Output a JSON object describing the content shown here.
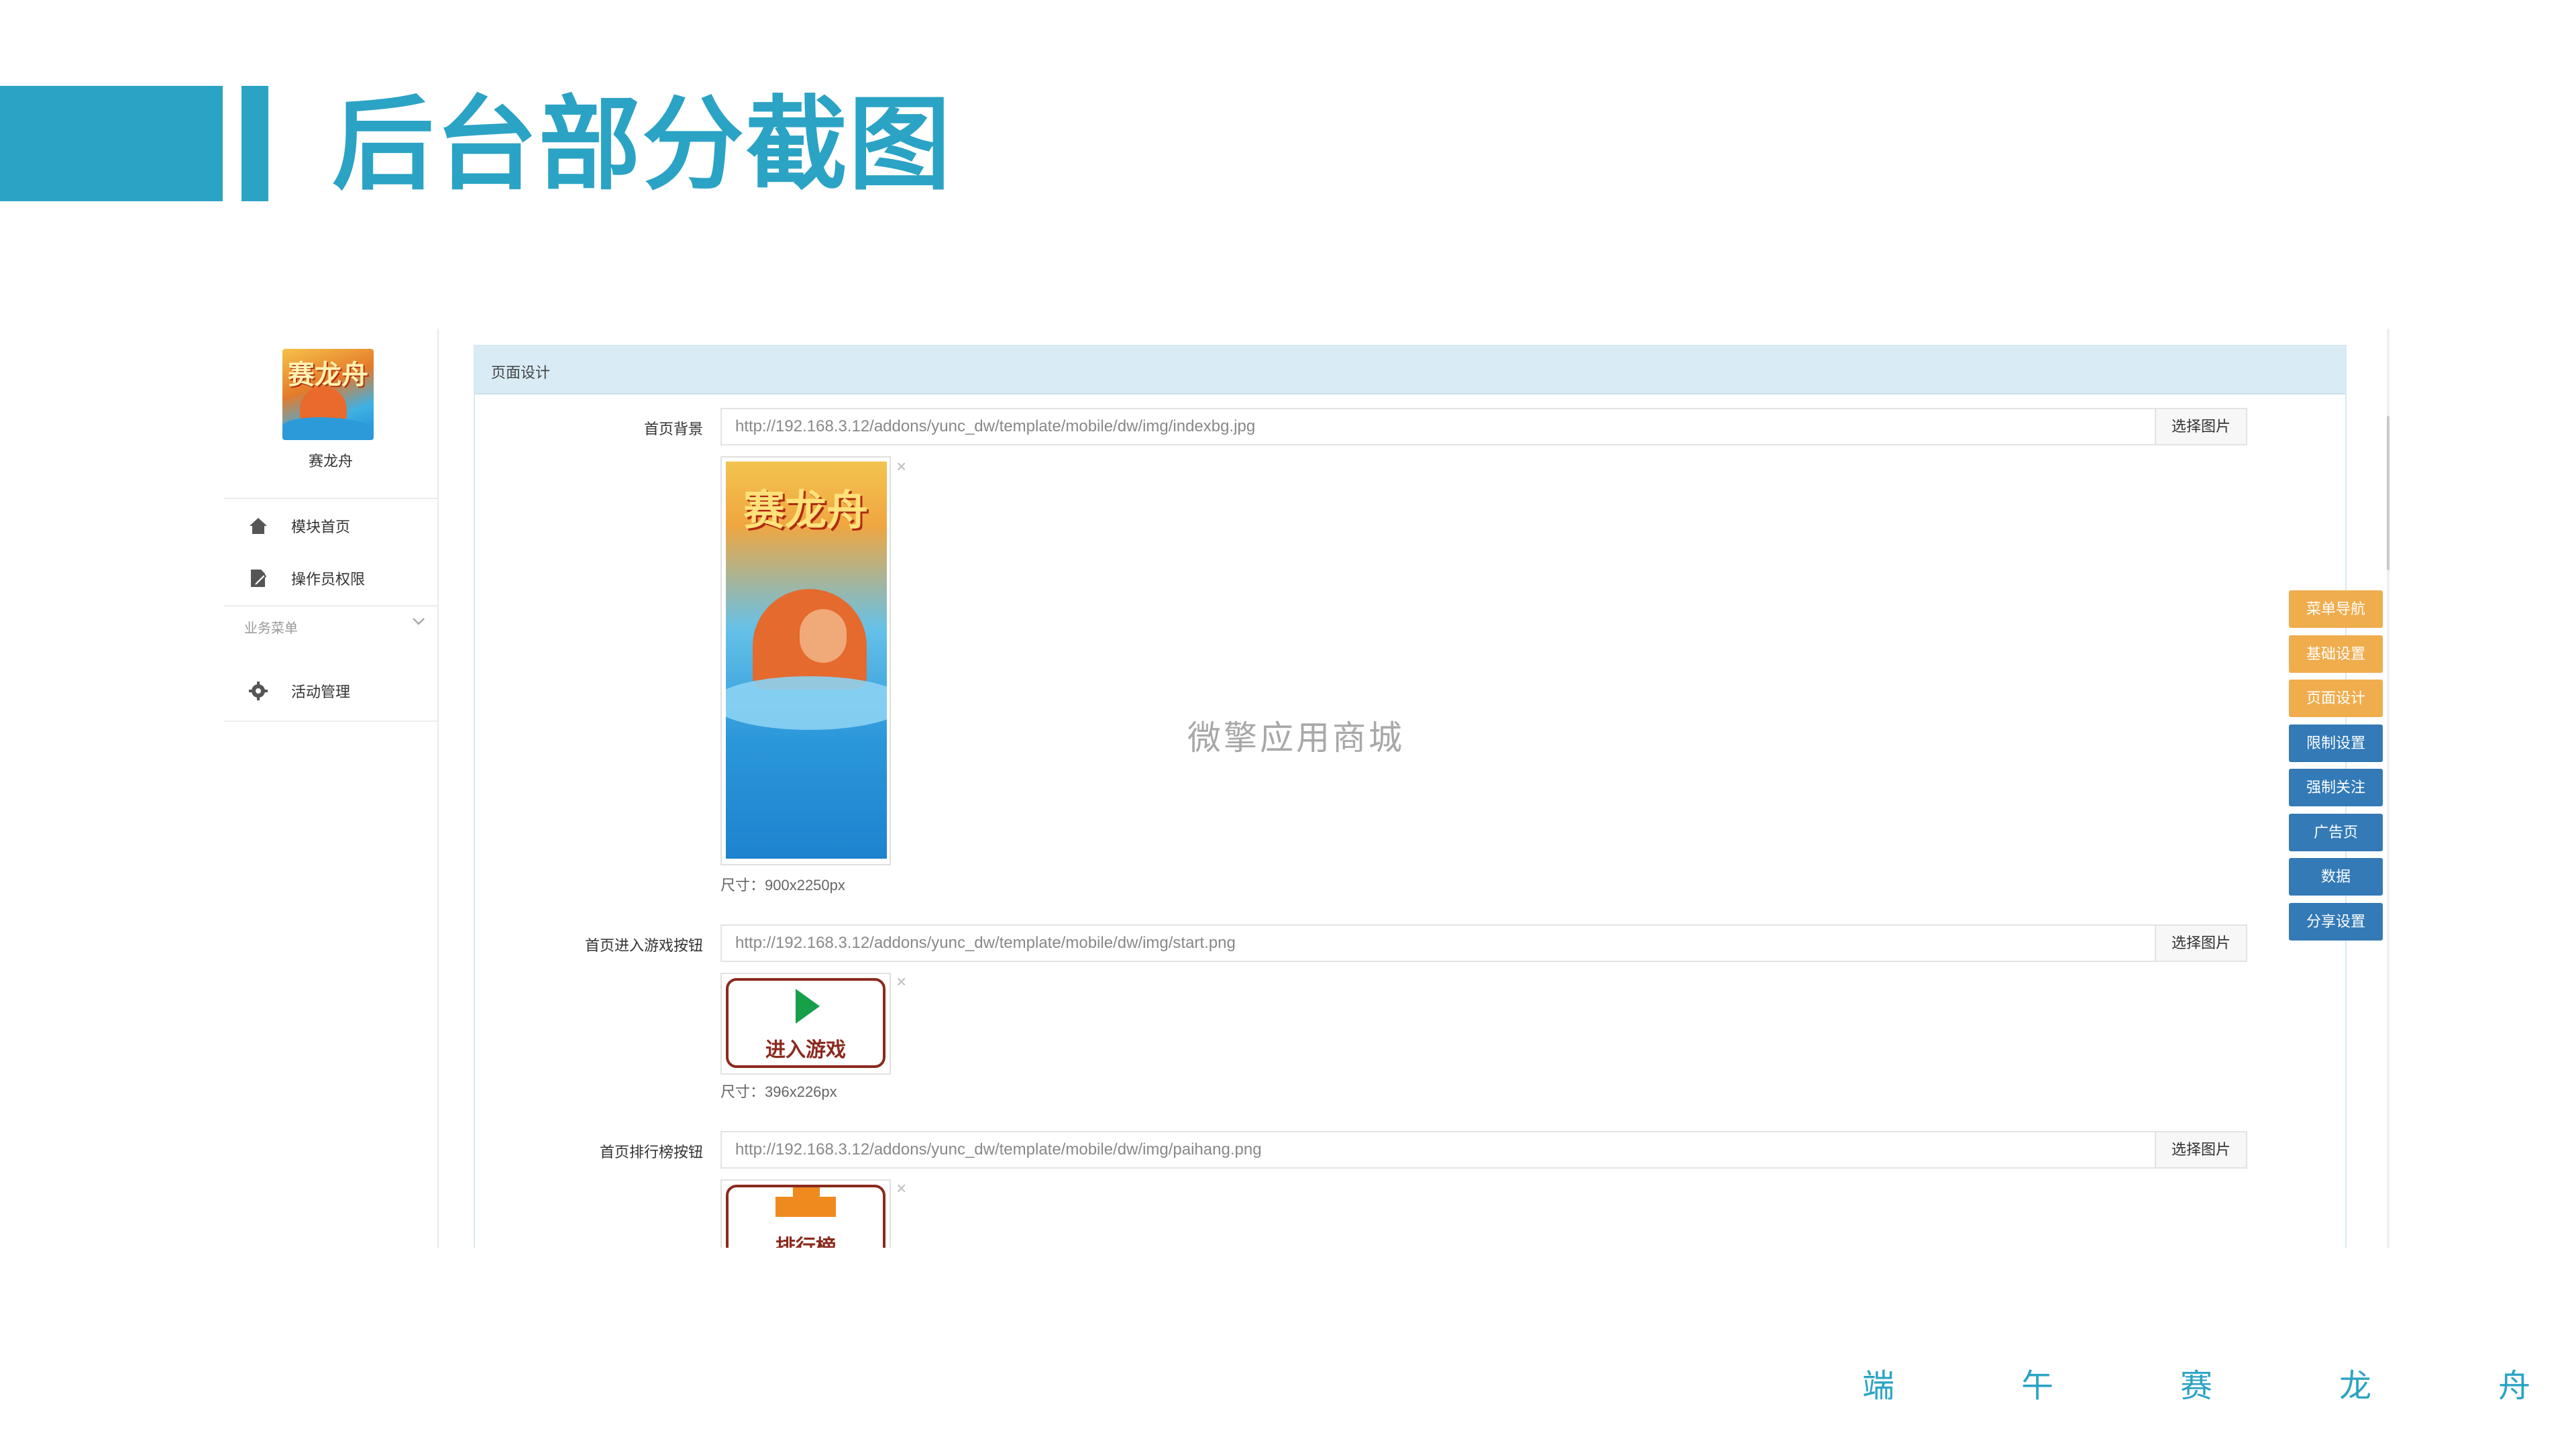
{
  "slide": {
    "title": "后台部分截图",
    "footer_chars": [
      "端",
      "午",
      "赛",
      "龙",
      "舟"
    ],
    "accent_color": "#2ba3c4"
  },
  "sidebar": {
    "app_name": "赛龙舟",
    "logo_text": "赛龙舟",
    "items": [
      {
        "label": "模块首页",
        "icon": "home-icon"
      },
      {
        "label": "操作员权限",
        "icon": "document-edit-icon"
      }
    ],
    "group_label": "业务菜单",
    "group_items": [
      {
        "label": "活动管理",
        "icon": "gear-icon"
      }
    ]
  },
  "panel": {
    "title": "页面设计",
    "fields": [
      {
        "label": "首页背景",
        "value": "http://192.168.3.12/addons/yunc_dw/template/mobile/dw/img/indexbg.jpg",
        "button": "选择图片",
        "close": "×",
        "size_note": "尺寸：900x2250px",
        "image_text": "赛龙舟"
      },
      {
        "label": "首页进入游戏按钮",
        "value": "http://192.168.3.12/addons/yunc_dw/template/mobile/dw/img/start.png",
        "button": "选择图片",
        "close": "×",
        "size_note": "尺寸：396x226px",
        "image_text": "进入游戏"
      },
      {
        "label": "首页排行榜按钮",
        "value": "http://192.168.3.12/addons/yunc_dw/template/mobile/dw/img/paihang.png",
        "button": "选择图片",
        "close": "×",
        "image_text": "排行榜"
      }
    ],
    "watermark": "微擎应用商城"
  },
  "float_nav": [
    {
      "label": "菜单导航",
      "color": "#f0ad4e"
    },
    {
      "label": "基础设置",
      "color": "#f0ad4e"
    },
    {
      "label": "页面设计",
      "color": "#f0ad4e"
    },
    {
      "label": "限制设置",
      "color": "#337ab7"
    },
    {
      "label": "强制关注",
      "color": "#337ab7"
    },
    {
      "label": "广告页",
      "color": "#337ab7"
    },
    {
      "label": "数据",
      "color": "#337ab7"
    },
    {
      "label": "分享设置",
      "color": "#337ab7"
    }
  ]
}
